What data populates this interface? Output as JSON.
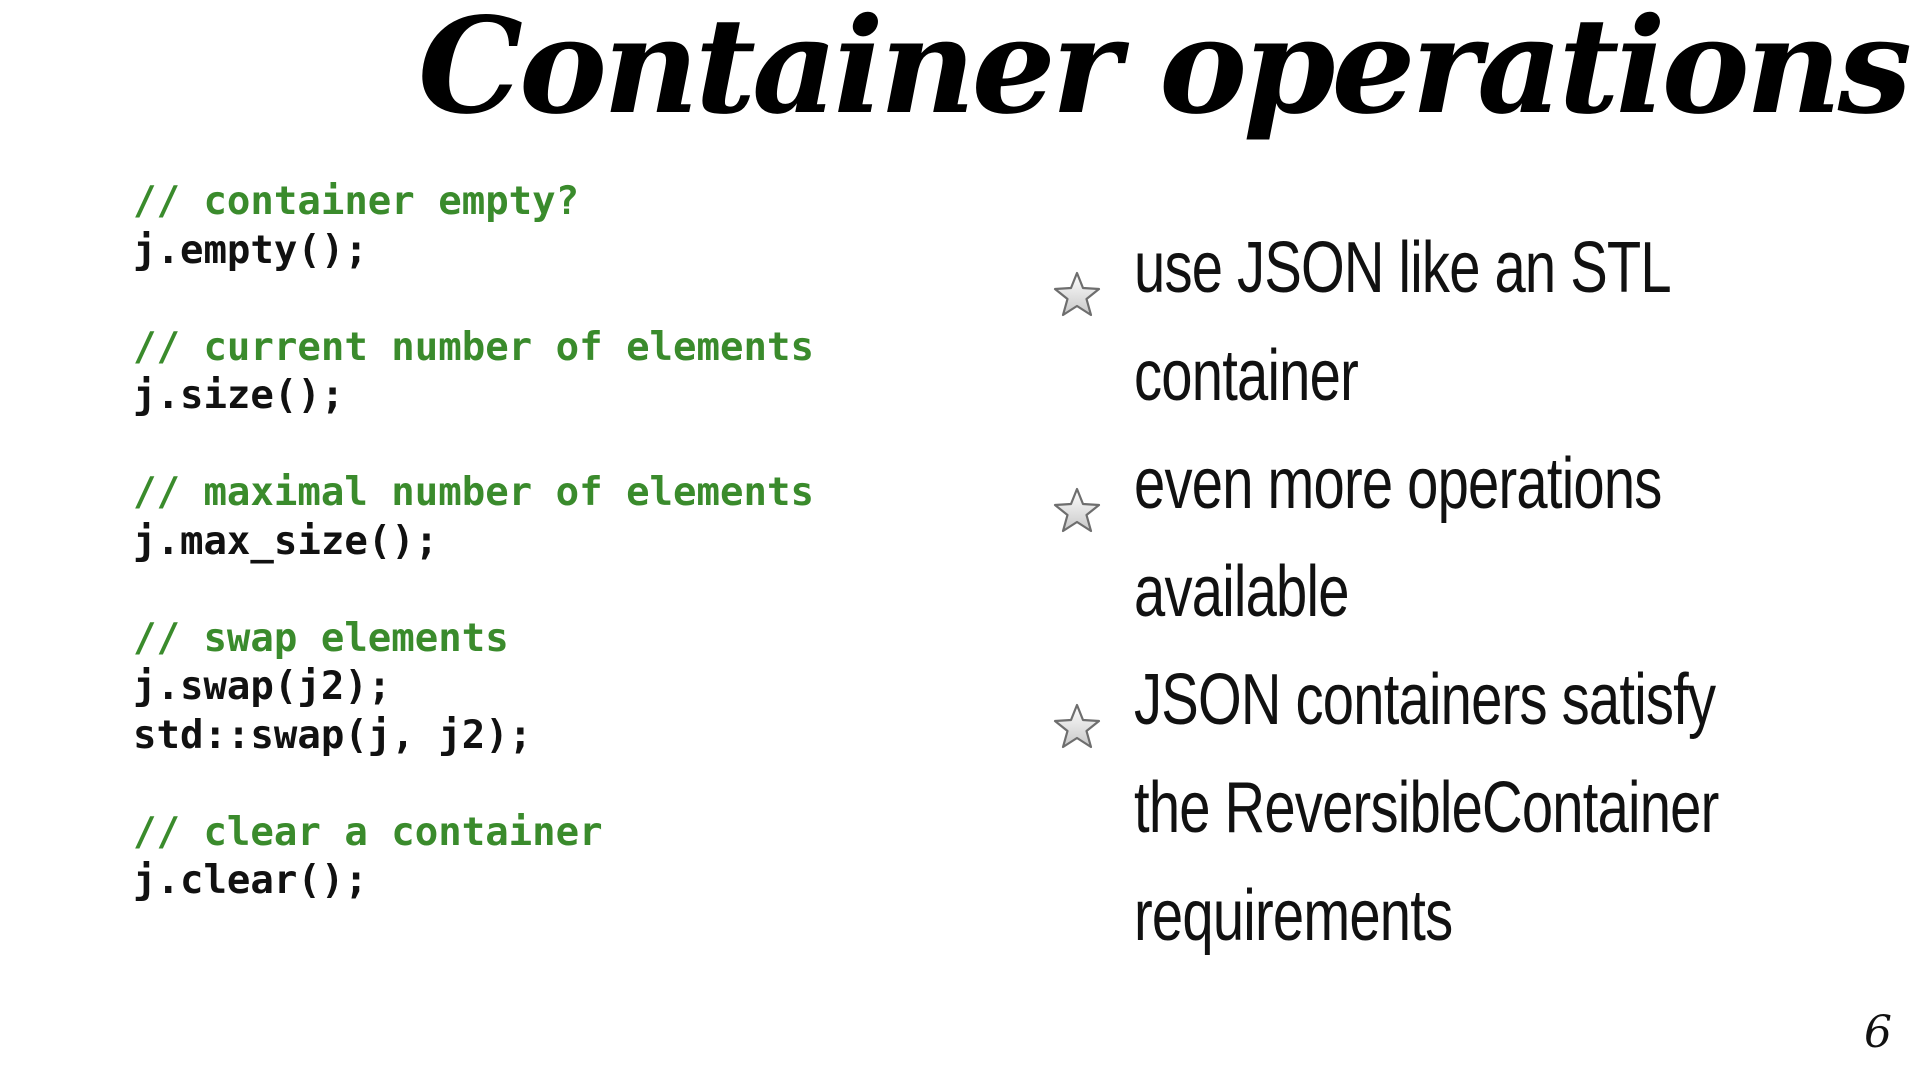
{
  "slide": {
    "title": "Container operations",
    "page_number": "6"
  },
  "code": {
    "blocks": [
      {
        "lines": [
          {
            "text": "// container empty?",
            "kind": "comment"
          },
          {
            "text": "j.empty();",
            "kind": "code"
          }
        ]
      },
      {
        "lines": [
          {
            "text": "// current number of elements",
            "kind": "comment"
          },
          {
            "text": "j.size();",
            "kind": "code"
          }
        ]
      },
      {
        "lines": [
          {
            "text": "// maximal number of elements",
            "kind": "comment"
          },
          {
            "text": "j.max_size();",
            "kind": "code"
          }
        ]
      },
      {
        "lines": [
          {
            "text": "// swap elements",
            "kind": "comment"
          },
          {
            "text": "j.swap(j2);",
            "kind": "code"
          },
          {
            "text": "std::swap(j, j2);",
            "kind": "code"
          }
        ]
      },
      {
        "lines": [
          {
            "text": "// clear a container",
            "kind": "comment"
          },
          {
            "text": "j.clear();",
            "kind": "code"
          }
        ]
      }
    ]
  },
  "bullets": {
    "icon": "star-icon",
    "items": [
      {
        "lines": [
          "use JSON like an STL",
          "container"
        ]
      },
      {
        "lines": [
          "even more operations",
          "available"
        ]
      },
      {
        "lines": [
          "JSON containers satisfy",
          "the ReversibleContainer",
          "requirements"
        ]
      }
    ]
  },
  "colors": {
    "comment": "#3a8b2c",
    "code": "#111111",
    "background": "#ffffff"
  }
}
